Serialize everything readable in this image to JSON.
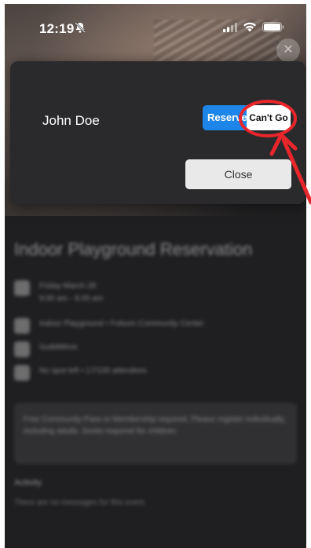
{
  "status_bar": {
    "time": "12:19",
    "silent_icon": "bell-slash-icon",
    "signal_icon": "cellular-signal-icon",
    "wifi_icon": "wifi-icon",
    "battery_icon": "battery-icon"
  },
  "rsvp_dialog": {
    "attendee_name": "John Doe",
    "reserved_label": "Reserved",
    "cant_go_label": "Can't Go",
    "close_label": "Close"
  },
  "event": {
    "title": "Indoor Playground Reservation",
    "date": "Friday March 28",
    "time_range": "9:00 am - 9:45 am",
    "location": "Indoor Playground • Folsom Community Center",
    "organizer": "GuildWires",
    "attendance": "No spot left • 17/100 attendees",
    "note": "Free Community Pass or Membership required. Please register individually, including adults. Socks required for children.",
    "activity_title": "Activity",
    "activity_empty": "There are no messages for this event"
  },
  "colors": {
    "accent_blue": "#1e86e8",
    "annotation_red": "#e8262b",
    "dialog_bg": "#2a2a2c"
  }
}
